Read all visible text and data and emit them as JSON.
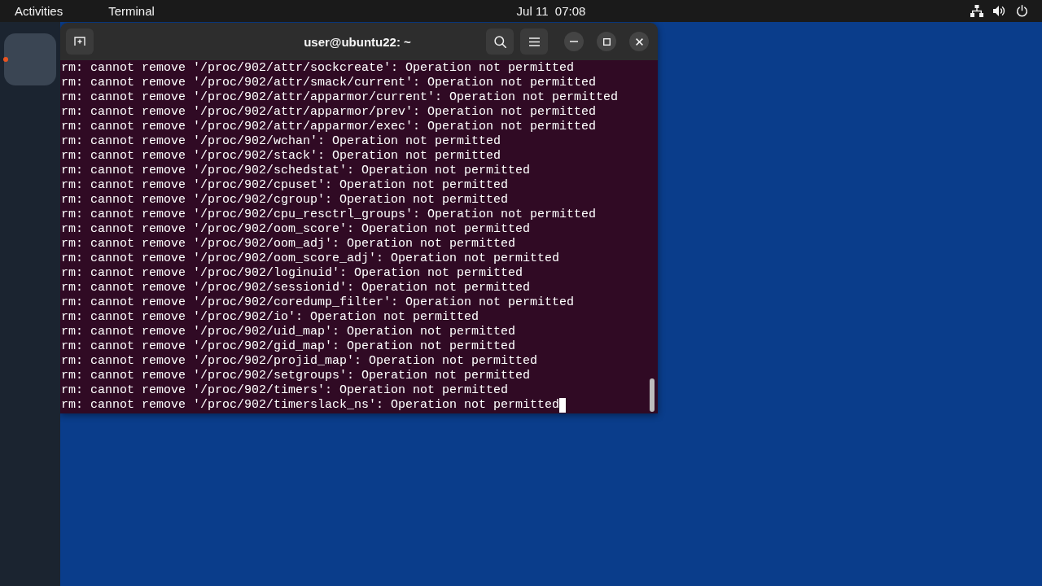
{
  "top_bar": {
    "activities": "Activities",
    "app_menu": "Terminal",
    "clock": "Jul 11  07:08"
  },
  "dock": {
    "apps": [
      {
        "running": true
      }
    ]
  },
  "terminal": {
    "title": "user@ubuntu22: ~",
    "cursor": true,
    "lines": [
      "rm: cannot remove '/proc/902/attr/sockcreate': Operation not permitted",
      "rm: cannot remove '/proc/902/attr/smack/current': Operation not permitted",
      "rm: cannot remove '/proc/902/attr/apparmor/current': Operation not permitted",
      "rm: cannot remove '/proc/902/attr/apparmor/prev': Operation not permitted",
      "rm: cannot remove '/proc/902/attr/apparmor/exec': Operation not permitted",
      "rm: cannot remove '/proc/902/wchan': Operation not permitted",
      "rm: cannot remove '/proc/902/stack': Operation not permitted",
      "rm: cannot remove '/proc/902/schedstat': Operation not permitted",
      "rm: cannot remove '/proc/902/cpuset': Operation not permitted",
      "rm: cannot remove '/proc/902/cgroup': Operation not permitted",
      "rm: cannot remove '/proc/902/cpu_resctrl_groups': Operation not permitted",
      "rm: cannot remove '/proc/902/oom_score': Operation not permitted",
      "rm: cannot remove '/proc/902/oom_adj': Operation not permitted",
      "rm: cannot remove '/proc/902/oom_score_adj': Operation not permitted",
      "rm: cannot remove '/proc/902/loginuid': Operation not permitted",
      "rm: cannot remove '/proc/902/sessionid': Operation not permitted",
      "rm: cannot remove '/proc/902/coredump_filter': Operation not permitted",
      "rm: cannot remove '/proc/902/io': Operation not permitted",
      "rm: cannot remove '/proc/902/uid_map': Operation not permitted",
      "rm: cannot remove '/proc/902/gid_map': Operation not permitted",
      "rm: cannot remove '/proc/902/projid_map': Operation not permitted",
      "rm: cannot remove '/proc/902/setgroups': Operation not permitted",
      "rm: cannot remove '/proc/902/timers': Operation not permitted",
      "rm: cannot remove '/proc/902/timerslack_ns': Operation not permitted"
    ]
  }
}
